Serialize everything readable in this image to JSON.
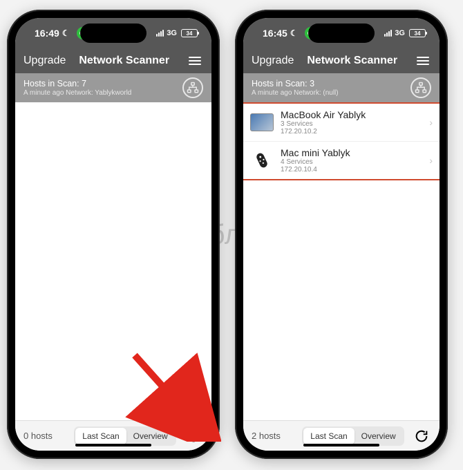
{
  "watermark": "Яблык",
  "left": {
    "status": {
      "time": "16:49",
      "network_type": "3G",
      "battery": "34"
    },
    "nav": {
      "upgrade": "Upgrade",
      "title": "Network Scanner"
    },
    "scan": {
      "line1": "Hosts in Scan: 7",
      "line2": "A minute ago  Network: Yablykworld"
    },
    "toolbar": {
      "hosts": "0 hosts",
      "seg_a": "Last Scan",
      "seg_b": "Overview"
    }
  },
  "right": {
    "status": {
      "time": "16:45",
      "network_type": "3G",
      "battery": "34"
    },
    "nav": {
      "upgrade": "Upgrade",
      "title": "Network Scanner"
    },
    "scan": {
      "line1": "Hosts in Scan: 3",
      "line2": "A minute ago  Network: (null)"
    },
    "hosts": [
      {
        "name": "MacBook Air  Yablyk",
        "services": "3 Services",
        "ip": "172.20.10.2",
        "icon": "laptop"
      },
      {
        "name": "Mac mini Yablyk",
        "services": "4 Services",
        "ip": "172.20.10.4",
        "icon": "remote"
      }
    ],
    "toolbar": {
      "hosts": "2 hosts",
      "seg_a": "Last Scan",
      "seg_b": "Overview"
    }
  }
}
